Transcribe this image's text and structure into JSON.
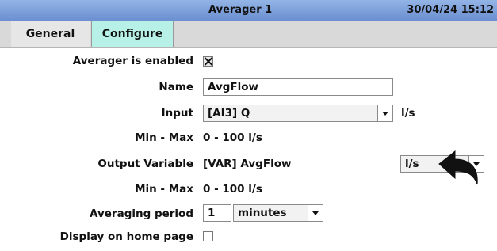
{
  "titlebar": {
    "title": "Averager 1",
    "datetime": "30/04/24 15:12"
  },
  "tabs": [
    {
      "label": "General"
    },
    {
      "label": "Configure"
    }
  ],
  "form": {
    "enabled_label": "Averager is enabled",
    "enabled": true,
    "name_label": "Name",
    "name_value": "AvgFlow",
    "input_label": "Input",
    "input_value": "[AI3] Q",
    "input_unit": "l/s",
    "minmax1_label": "Min - Max",
    "minmax1_value": "0 - 100 l/s",
    "output_label": "Output Variable",
    "output_value": "[VAR] AvgFlow",
    "output_unit_select": "l/s",
    "minmax2_label": "Min - Max",
    "minmax2_value": "0 - 100 l/s",
    "period_label": "Averaging period",
    "period_value": "1",
    "period_unit": "minutes",
    "home_label": "Display on home page",
    "home_checked": false
  },
  "icons": {
    "back": "back-arrow-icon"
  },
  "colors": {
    "titlebar": "#7f9fdc",
    "active_tab": "#b6f0e6",
    "inactive_tab": "#e6e6e6"
  }
}
